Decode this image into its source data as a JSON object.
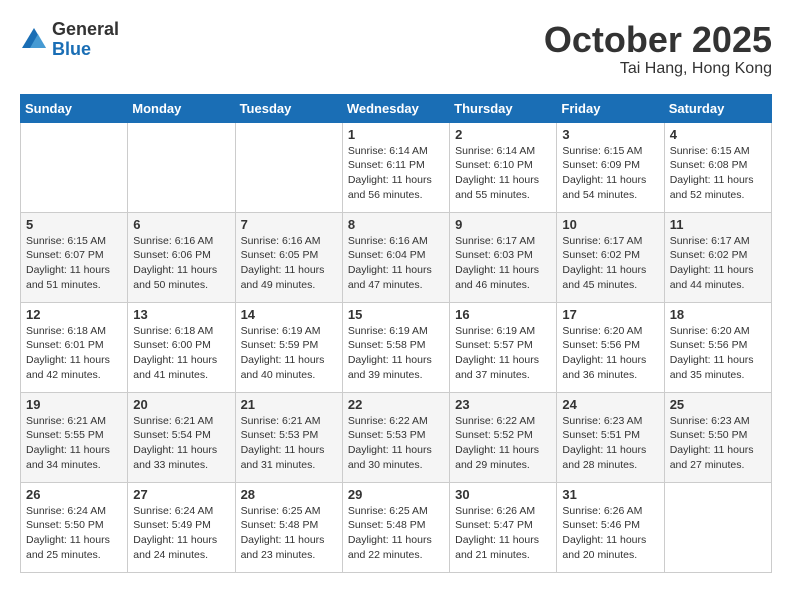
{
  "header": {
    "logo_general": "General",
    "logo_blue": "Blue",
    "month": "October 2025",
    "location": "Tai Hang, Hong Kong"
  },
  "days_of_week": [
    "Sunday",
    "Monday",
    "Tuesday",
    "Wednesday",
    "Thursday",
    "Friday",
    "Saturday"
  ],
  "weeks": [
    [
      {
        "day": "",
        "content": ""
      },
      {
        "day": "",
        "content": ""
      },
      {
        "day": "",
        "content": ""
      },
      {
        "day": "1",
        "content": "Sunrise: 6:14 AM\nSunset: 6:11 PM\nDaylight: 11 hours\nand 56 minutes."
      },
      {
        "day": "2",
        "content": "Sunrise: 6:14 AM\nSunset: 6:10 PM\nDaylight: 11 hours\nand 55 minutes."
      },
      {
        "day": "3",
        "content": "Sunrise: 6:15 AM\nSunset: 6:09 PM\nDaylight: 11 hours\nand 54 minutes."
      },
      {
        "day": "4",
        "content": "Sunrise: 6:15 AM\nSunset: 6:08 PM\nDaylight: 11 hours\nand 52 minutes."
      }
    ],
    [
      {
        "day": "5",
        "content": "Sunrise: 6:15 AM\nSunset: 6:07 PM\nDaylight: 11 hours\nand 51 minutes."
      },
      {
        "day": "6",
        "content": "Sunrise: 6:16 AM\nSunset: 6:06 PM\nDaylight: 11 hours\nand 50 minutes."
      },
      {
        "day": "7",
        "content": "Sunrise: 6:16 AM\nSunset: 6:05 PM\nDaylight: 11 hours\nand 49 minutes."
      },
      {
        "day": "8",
        "content": "Sunrise: 6:16 AM\nSunset: 6:04 PM\nDaylight: 11 hours\nand 47 minutes."
      },
      {
        "day": "9",
        "content": "Sunrise: 6:17 AM\nSunset: 6:03 PM\nDaylight: 11 hours\nand 46 minutes."
      },
      {
        "day": "10",
        "content": "Sunrise: 6:17 AM\nSunset: 6:02 PM\nDaylight: 11 hours\nand 45 minutes."
      },
      {
        "day": "11",
        "content": "Sunrise: 6:17 AM\nSunset: 6:02 PM\nDaylight: 11 hours\nand 44 minutes."
      }
    ],
    [
      {
        "day": "12",
        "content": "Sunrise: 6:18 AM\nSunset: 6:01 PM\nDaylight: 11 hours\nand 42 minutes."
      },
      {
        "day": "13",
        "content": "Sunrise: 6:18 AM\nSunset: 6:00 PM\nDaylight: 11 hours\nand 41 minutes."
      },
      {
        "day": "14",
        "content": "Sunrise: 6:19 AM\nSunset: 5:59 PM\nDaylight: 11 hours\nand 40 minutes."
      },
      {
        "day": "15",
        "content": "Sunrise: 6:19 AM\nSunset: 5:58 PM\nDaylight: 11 hours\nand 39 minutes."
      },
      {
        "day": "16",
        "content": "Sunrise: 6:19 AM\nSunset: 5:57 PM\nDaylight: 11 hours\nand 37 minutes."
      },
      {
        "day": "17",
        "content": "Sunrise: 6:20 AM\nSunset: 5:56 PM\nDaylight: 11 hours\nand 36 minutes."
      },
      {
        "day": "18",
        "content": "Sunrise: 6:20 AM\nSunset: 5:56 PM\nDaylight: 11 hours\nand 35 minutes."
      }
    ],
    [
      {
        "day": "19",
        "content": "Sunrise: 6:21 AM\nSunset: 5:55 PM\nDaylight: 11 hours\nand 34 minutes."
      },
      {
        "day": "20",
        "content": "Sunrise: 6:21 AM\nSunset: 5:54 PM\nDaylight: 11 hours\nand 33 minutes."
      },
      {
        "day": "21",
        "content": "Sunrise: 6:21 AM\nSunset: 5:53 PM\nDaylight: 11 hours\nand 31 minutes."
      },
      {
        "day": "22",
        "content": "Sunrise: 6:22 AM\nSunset: 5:53 PM\nDaylight: 11 hours\nand 30 minutes."
      },
      {
        "day": "23",
        "content": "Sunrise: 6:22 AM\nSunset: 5:52 PM\nDaylight: 11 hours\nand 29 minutes."
      },
      {
        "day": "24",
        "content": "Sunrise: 6:23 AM\nSunset: 5:51 PM\nDaylight: 11 hours\nand 28 minutes."
      },
      {
        "day": "25",
        "content": "Sunrise: 6:23 AM\nSunset: 5:50 PM\nDaylight: 11 hours\nand 27 minutes."
      }
    ],
    [
      {
        "day": "26",
        "content": "Sunrise: 6:24 AM\nSunset: 5:50 PM\nDaylight: 11 hours\nand 25 minutes."
      },
      {
        "day": "27",
        "content": "Sunrise: 6:24 AM\nSunset: 5:49 PM\nDaylight: 11 hours\nand 24 minutes."
      },
      {
        "day": "28",
        "content": "Sunrise: 6:25 AM\nSunset: 5:48 PM\nDaylight: 11 hours\nand 23 minutes."
      },
      {
        "day": "29",
        "content": "Sunrise: 6:25 AM\nSunset: 5:48 PM\nDaylight: 11 hours\nand 22 minutes."
      },
      {
        "day": "30",
        "content": "Sunrise: 6:26 AM\nSunset: 5:47 PM\nDaylight: 11 hours\nand 21 minutes."
      },
      {
        "day": "31",
        "content": "Sunrise: 6:26 AM\nSunset: 5:46 PM\nDaylight: 11 hours\nand 20 minutes."
      },
      {
        "day": "",
        "content": ""
      }
    ]
  ]
}
